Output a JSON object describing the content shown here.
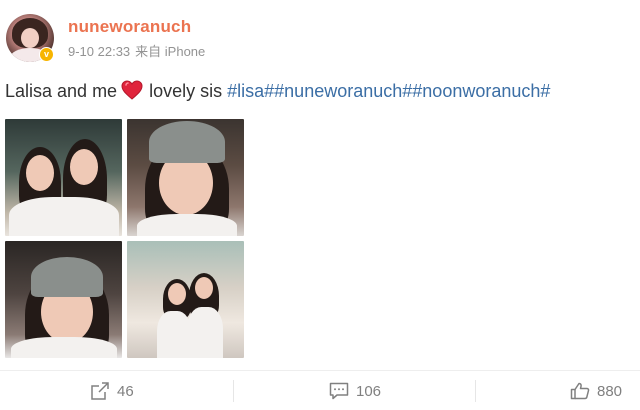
{
  "post": {
    "username": "nuneworanuch",
    "time": "9-10 22:33",
    "source": "来自 iPhone",
    "text_prefix": "Lalisa and me",
    "text_middle": "lovely sis",
    "hashtags": [
      "#lisa#",
      "#nuneworanuch#",
      "#noonworanuch#"
    ],
    "verified_badge": "v",
    "icons": {
      "avatar": "profile-photo",
      "verified": "verified-badge-icon",
      "heart": "red-heart-emoji",
      "share": "share-icon",
      "comment": "comment-icon",
      "like": "thumbs-up-icon"
    },
    "colors": {
      "username": "#eb7350",
      "hashtag": "#3b6ea5",
      "meta": "#939393",
      "verified": "#f7b500",
      "heart": "#e0243c"
    }
  },
  "images": [
    {
      "label": "photo-1"
    },
    {
      "label": "photo-2"
    },
    {
      "label": "photo-3"
    },
    {
      "label": "photo-4"
    }
  ],
  "actions": {
    "shares": "46",
    "comments": "106",
    "likes": "880"
  }
}
